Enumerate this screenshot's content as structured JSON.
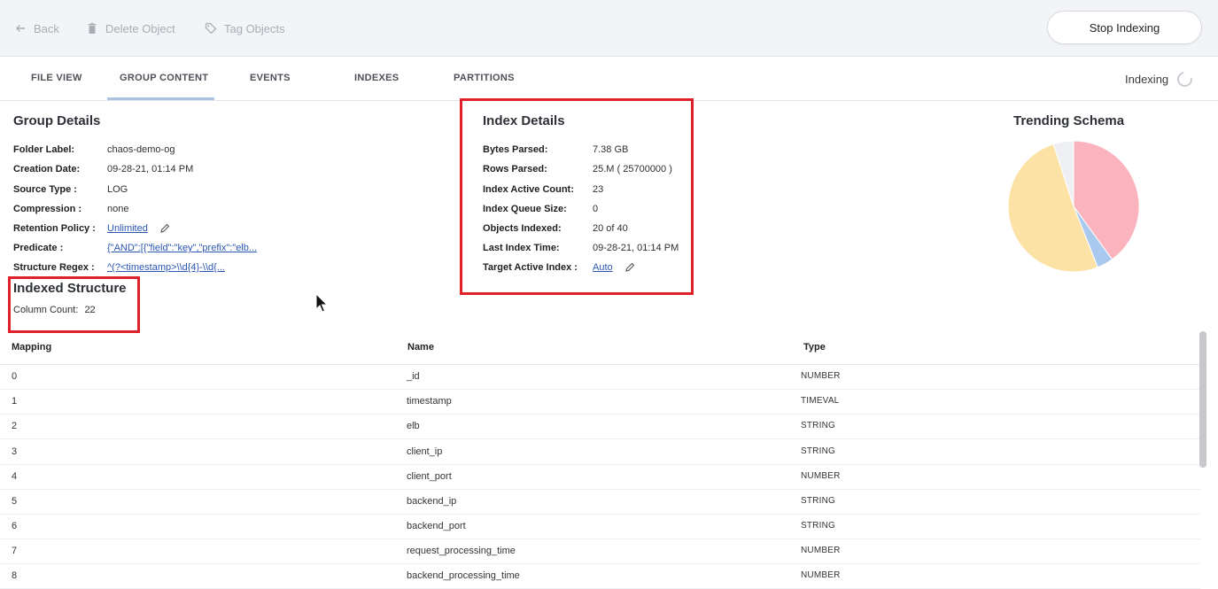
{
  "toolbar": {
    "back_label": "Back",
    "delete_label": "Delete Object",
    "tag_label": "Tag Objects",
    "stop_label": "Stop Indexing"
  },
  "tabs": [
    {
      "label": "FILE VIEW"
    },
    {
      "label": "GROUP CONTENT"
    },
    {
      "label": "EVENTS"
    },
    {
      "label": "INDEXES"
    },
    {
      "label": "PARTITIONS"
    }
  ],
  "status": {
    "label": "Indexing"
  },
  "group_details": {
    "title": "Group Details",
    "folder_label_key": "Folder Label:",
    "folder_label_value": "chaos-demo-og",
    "creation_date_key": "Creation Date:",
    "creation_date_value": "09-28-21, 01:14 PM",
    "source_type_key": "Source Type :",
    "source_type_value": "LOG",
    "compression_key": "Compression :",
    "compression_value": "none",
    "retention_key": "Retention Policy :",
    "retention_value": "Unlimited",
    "predicate_key": "Predicate :",
    "predicate_value": "{\"AND\":[{\"field\":\"key\",\"prefix\":\"elb...",
    "regex_key": "Structure Regex :",
    "regex_value": "^(?<timestamp>\\\\d{4}-\\\\d{..."
  },
  "index_details": {
    "title": "Index Details",
    "bytes_key": "Bytes Parsed:",
    "bytes_value": "7.38 GB",
    "rows_key": "Rows Parsed:",
    "rows_value": "25.M ( 25700000 )",
    "active_key": "Index Active Count:",
    "active_value": "23",
    "queue_key": "Index Queue Size:",
    "queue_value": "0",
    "objects_key": "Objects Indexed:",
    "objects_value": "20 of 40",
    "last_key": "Last Index Time:",
    "last_value": "09-28-21, 01:14 PM",
    "target_key": "Target Active Index :",
    "target_value": "Auto"
  },
  "trending": {
    "title": "Trending Schema",
    "slices": [
      {
        "value": 40,
        "color": "#fbb4bd"
      },
      {
        "value": 4,
        "color": "#a9c9ef"
      },
      {
        "value": 51,
        "color": "#fde2a6"
      },
      {
        "value": 5,
        "color": "#eff0f3"
      }
    ]
  },
  "indexed_structure": {
    "title": "Indexed Structure",
    "column_count_key": "Column Count:",
    "column_count_value": "22"
  },
  "table": {
    "headers": [
      "Mapping",
      "Name",
      "Type"
    ],
    "rows": [
      {
        "mapping": "0",
        "name": "_id",
        "type": "NUMBER"
      },
      {
        "mapping": "1",
        "name": "timestamp",
        "type": "TIMEVAL"
      },
      {
        "mapping": "2",
        "name": "elb",
        "type": "STRING"
      },
      {
        "mapping": "3",
        "name": "client_ip",
        "type": "STRING"
      },
      {
        "mapping": "4",
        "name": "client_port",
        "type": "NUMBER"
      },
      {
        "mapping": "5",
        "name": "backend_ip",
        "type": "STRING"
      },
      {
        "mapping": "6",
        "name": "backend_port",
        "type": "STRING"
      },
      {
        "mapping": "7",
        "name": "request_processing_time",
        "type": "NUMBER"
      },
      {
        "mapping": "8",
        "name": "backend_processing_time",
        "type": "NUMBER"
      }
    ]
  }
}
